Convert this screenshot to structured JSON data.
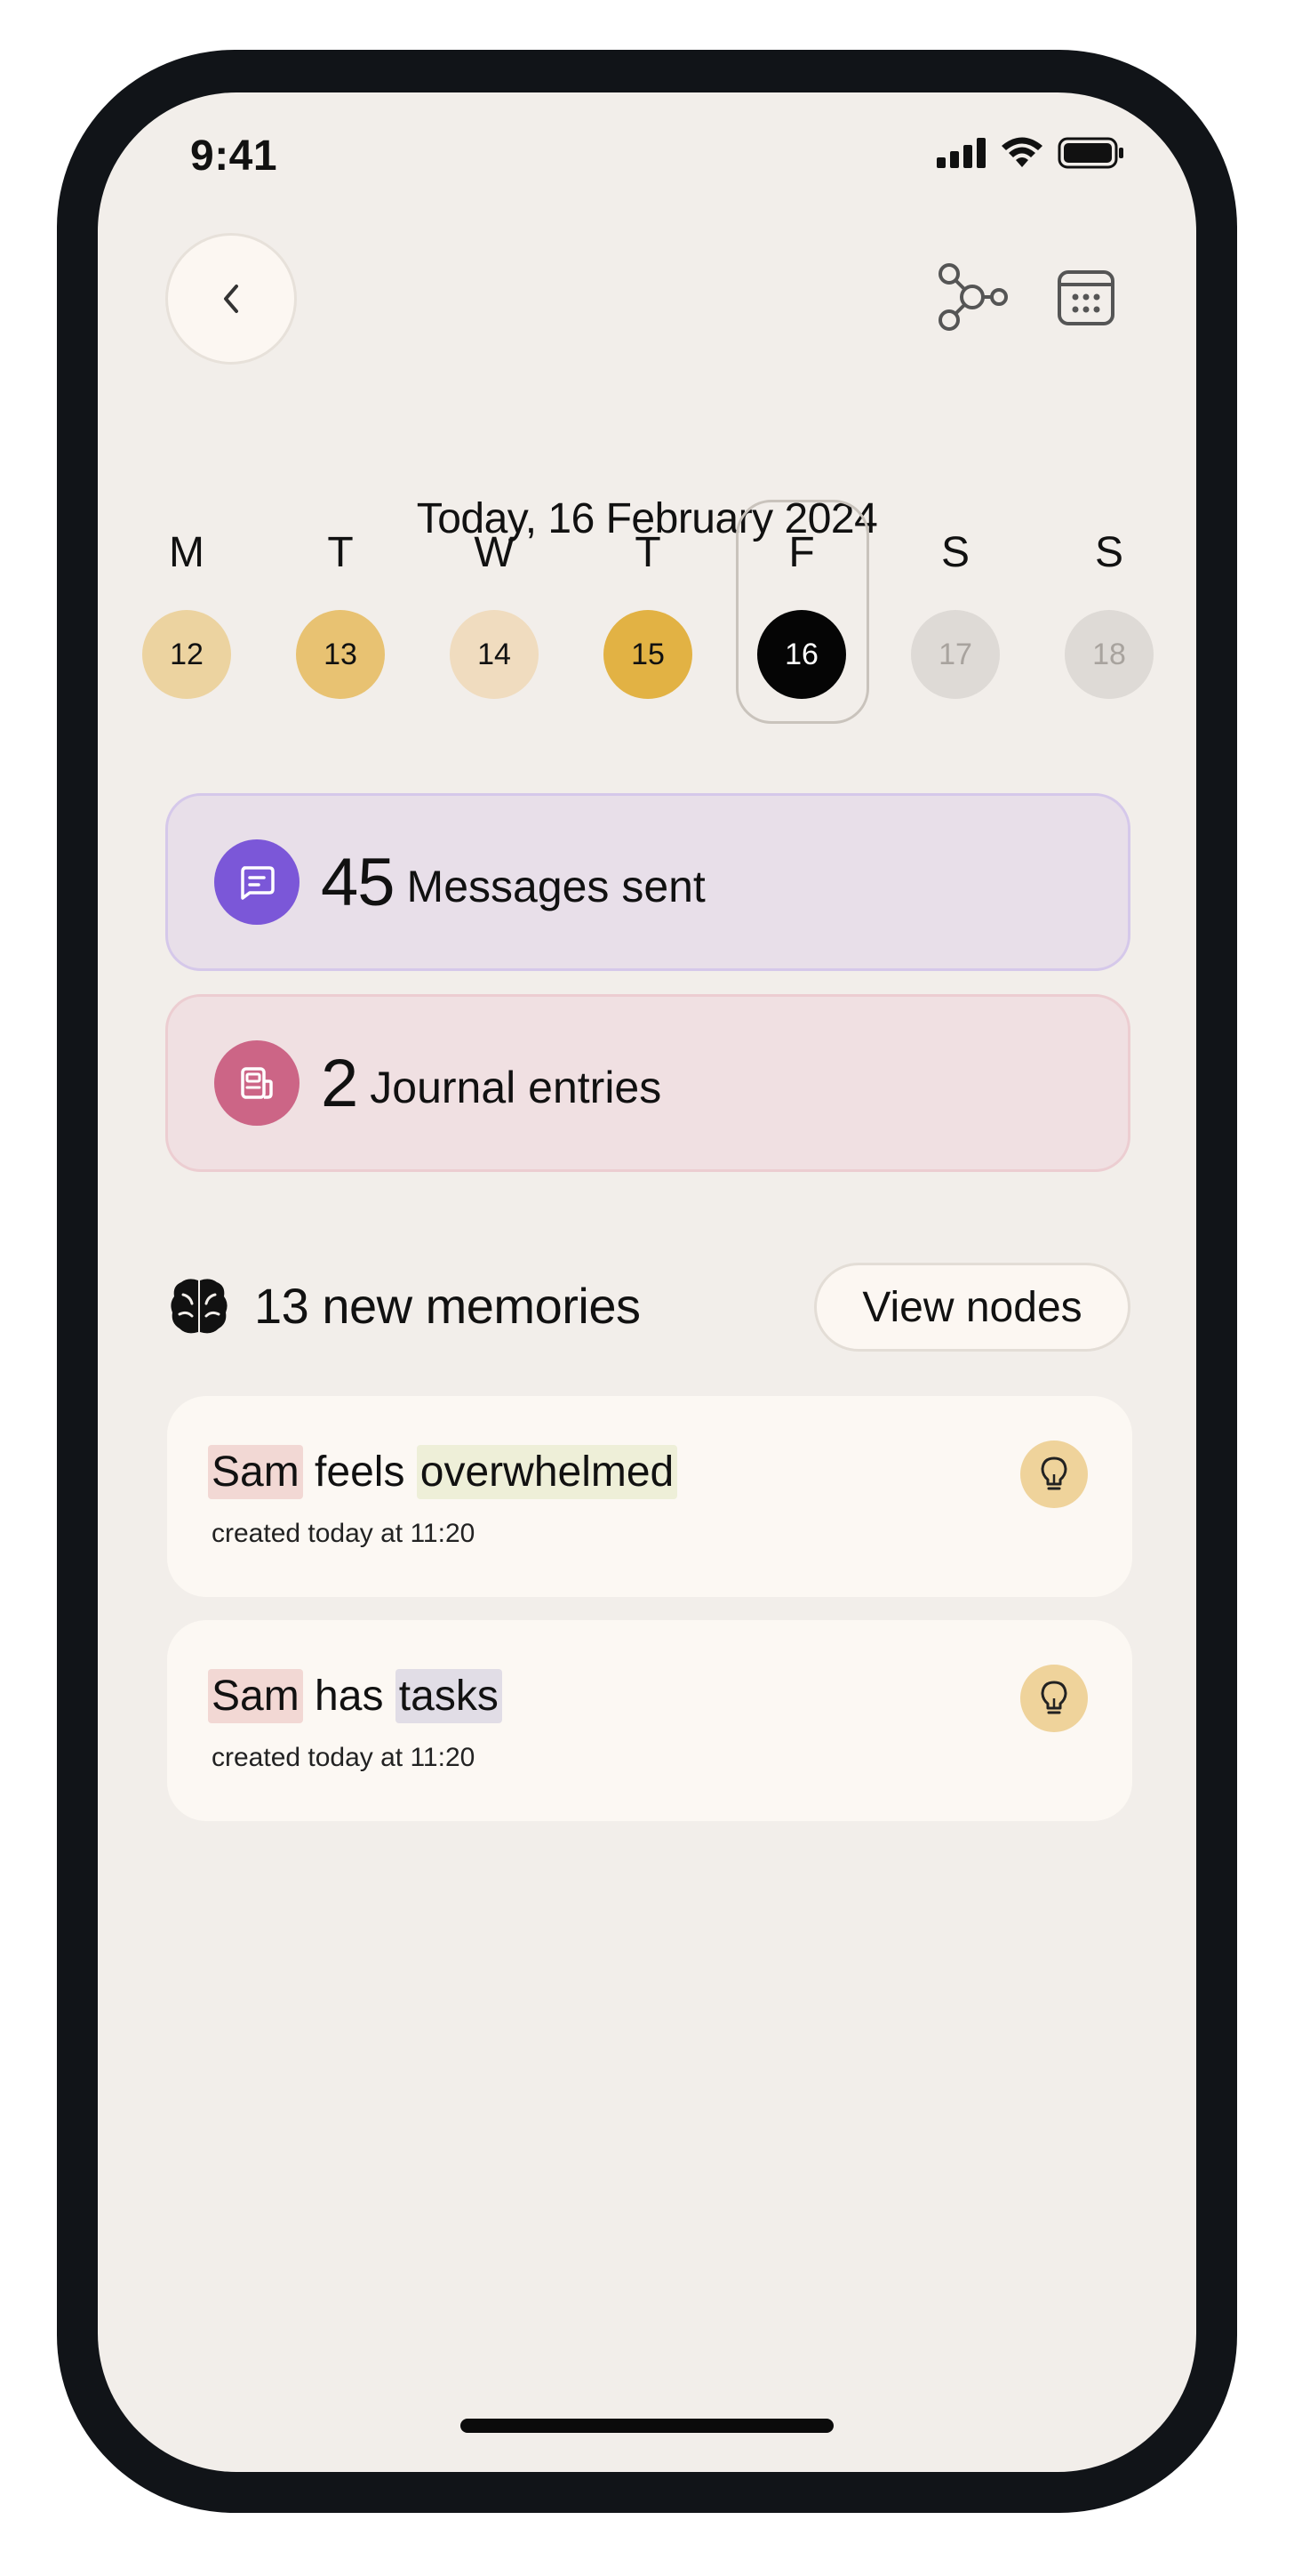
{
  "status_bar": {
    "time": "9:41"
  },
  "header": {
    "date_title": "Today, 16 February 2024"
  },
  "week": {
    "days": [
      {
        "letter": "M",
        "date": "12",
        "bg": "#ecd3a0",
        "fg": "#111111"
      },
      {
        "letter": "T",
        "date": "13",
        "bg": "#e8c272",
        "fg": "#111111"
      },
      {
        "letter": "W",
        "date": "14",
        "bg": "#f0dcbf",
        "fg": "#111111"
      },
      {
        "letter": "T",
        "date": "15",
        "bg": "#e2b244",
        "fg": "#111111"
      },
      {
        "letter": "F",
        "date": "16",
        "bg": "#050505",
        "fg": "#ffffff"
      },
      {
        "letter": "S",
        "date": "17",
        "bg": "#dedad6",
        "fg": "#a8a39e"
      },
      {
        "letter": "S",
        "date": "18",
        "bg": "#dedad6",
        "fg": "#a8a39e"
      }
    ],
    "selected_index": 4
  },
  "stats": {
    "messages": {
      "count": "45",
      "label": "Messages sent",
      "icon_color": "#7b57d8"
    },
    "journal": {
      "count": "2",
      "label": "Journal entries",
      "icon_color": "#cc6586"
    }
  },
  "memories": {
    "title": "13 new memories",
    "view_nodes_label": "View nodes",
    "items": [
      {
        "subject": "Sam",
        "verb": "feels",
        "object": "overwhelmed",
        "meta": "created today at 11:20"
      },
      {
        "subject": "Sam",
        "verb": "has",
        "object": "tasks",
        "meta": "created today at 11:20"
      }
    ]
  },
  "icons": {
    "back": "chevron-left-icon",
    "nodes": "graph-nodes-icon",
    "calendar": "calendar-icon",
    "messages": "message-square-icon",
    "journal": "journal-icon",
    "brain": "brain-icon",
    "memory": "lightbulb-icon"
  }
}
